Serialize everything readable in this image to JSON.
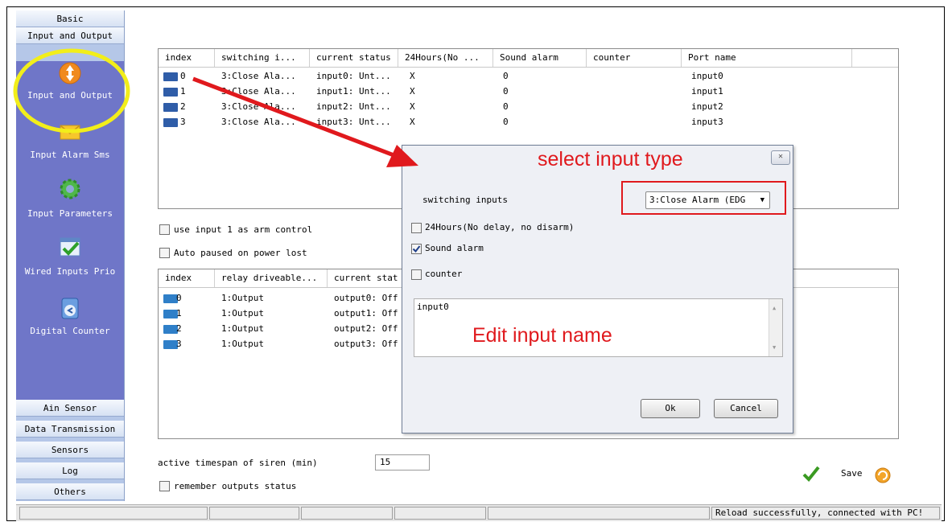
{
  "sidebar": {
    "top_buttons": [
      "Basic",
      "Input and Output"
    ],
    "items": [
      {
        "label": "Input and Output",
        "icon": "input-output-icon"
      },
      {
        "label": "Input Alarm Sms",
        "icon": "envelope-icon"
      },
      {
        "label": "Input Parameters",
        "icon": "gear-icon"
      },
      {
        "label": "Wired Inputs Prio",
        "icon": "checkmark-icon"
      },
      {
        "label": "Digital Counter",
        "icon": "counter-icon"
      }
    ],
    "bottom_buttons": [
      "Ain Sensor",
      "Data Transmission",
      "Sensors",
      "Log",
      "Others"
    ]
  },
  "input_table": {
    "headers": [
      "index",
      "switching i...",
      "current status",
      "24Hours(No ...",
      "Sound alarm",
      "counter",
      "Port name"
    ],
    "rows": [
      {
        "index": "0",
        "switching": "3:Close Ala...",
        "status": "input0: Unt...",
        "h24": "X",
        "sound": "0",
        "port": "input0"
      },
      {
        "index": "1",
        "switching": "3:Close Ala...",
        "status": "input1: Unt...",
        "h24": "X",
        "sound": "0",
        "port": "input1"
      },
      {
        "index": "2",
        "switching": "3:Close Ala...",
        "status": "input2: Unt...",
        "h24": "X",
        "sound": "0",
        "port": "input2"
      },
      {
        "index": "3",
        "switching": "3:Close Ala...",
        "status": "input3: Unt...",
        "h24": "X",
        "sound": "0",
        "port": "input3"
      }
    ]
  },
  "options": {
    "arm_control": "use input 1 as arm control",
    "auto_paused": "Auto paused on power lost"
  },
  "output_table": {
    "headers": [
      "index",
      "relay driveable...",
      "current stat"
    ],
    "rows": [
      {
        "index": "0",
        "relay": "1:Output",
        "status": "output0: Off"
      },
      {
        "index": "1",
        "relay": "1:Output",
        "status": "output1: Off"
      },
      {
        "index": "2",
        "relay": "1:Output",
        "status": "output2: Off"
      },
      {
        "index": "3",
        "relay": "1:Output",
        "status": "output3: Off"
      }
    ]
  },
  "siren": {
    "label": "active timespan of siren (min)",
    "value": "15",
    "remember": "remember outputs status"
  },
  "save_label": "Save",
  "dialog": {
    "switching_label": "switching inputs",
    "select_value": "3:Close Alarm (EDG",
    "h24_label": "24Hours(No delay, no disarm)",
    "sound_label": "Sound alarm",
    "sound_checked": true,
    "counter_label": "counter",
    "name_value": "input0",
    "ok_label": "Ok",
    "cancel_label": "Cancel",
    "close_label": "✕"
  },
  "annotations": {
    "select_type": "select input type",
    "edit_name": "Edit input name",
    "color": "#e0191d",
    "highlight_color": "#f2ee1a"
  },
  "status_bar": {
    "message": "Reload successfully, connected with PC!"
  }
}
